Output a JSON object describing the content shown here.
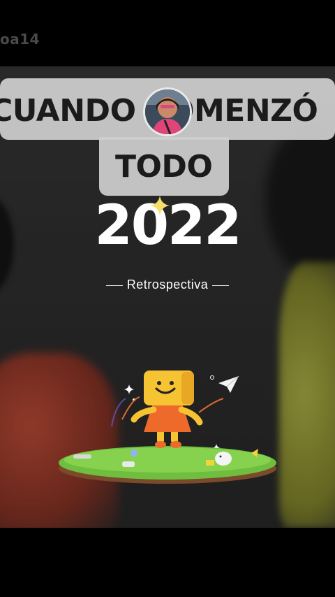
{
  "watermark": "oa14",
  "caption": {
    "line1": "CUANDO COMENZÓ",
    "line2": "TODO"
  },
  "overlay": {
    "year": "2022",
    "subtitle": "Retrospectiva"
  },
  "colors": {
    "caption_bg": "#cfcfcf",
    "mascot_yellow": "#f6c332",
    "mascot_orange": "#ee6a2a",
    "grass": "#6fbe3f"
  }
}
